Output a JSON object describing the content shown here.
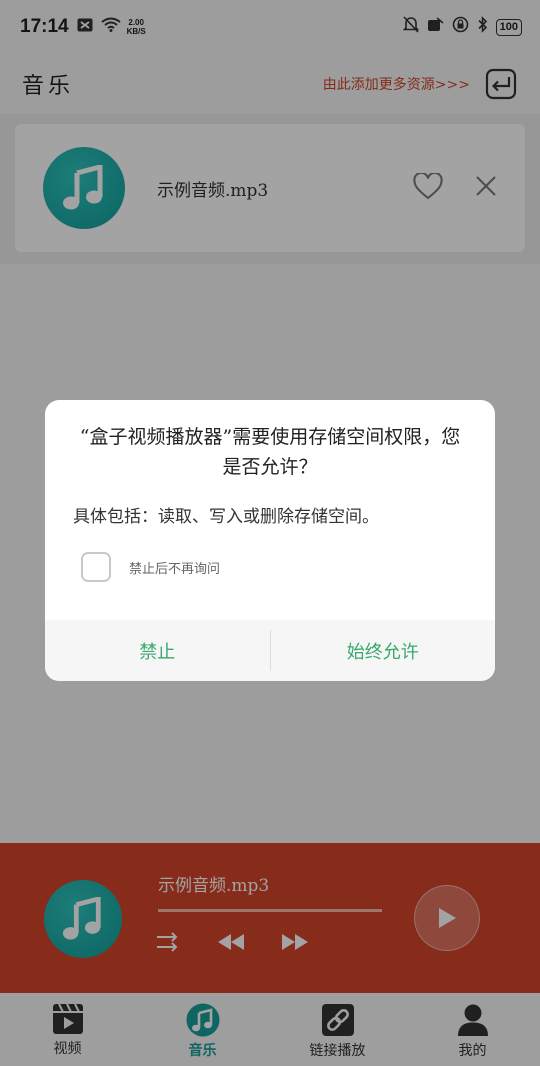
{
  "statusbar": {
    "time": "17:14",
    "speed_value": "2.00",
    "speed_unit": "KB/S",
    "battery": "100"
  },
  "header": {
    "title": "音乐",
    "add_link": "由此添加更多资源>>>"
  },
  "playlist": {
    "items": [
      {
        "name": "示例音频.mp3"
      }
    ]
  },
  "player": {
    "now_playing": "示例音频.mp3",
    "progress_fraction": 0
  },
  "nav": {
    "items": [
      {
        "label": "视频"
      },
      {
        "label": "音乐"
      },
      {
        "label": "链接播放"
      },
      {
        "label": "我的"
      }
    ],
    "active_index": 1
  },
  "dialog": {
    "title": "“盒子视频播放器”需要使用存储空间权限，您是否允许？",
    "description": "具体包括：读取、写入或删除存储空间。",
    "checkbox_label": "禁止后不再询问",
    "deny_label": "禁止",
    "allow_label": "始终允许"
  },
  "colors": {
    "accent_teal": "#169e98",
    "player_red": "#d4442a",
    "link_red": "#d0442a",
    "dialog_button_green": "#3aa86e"
  }
}
